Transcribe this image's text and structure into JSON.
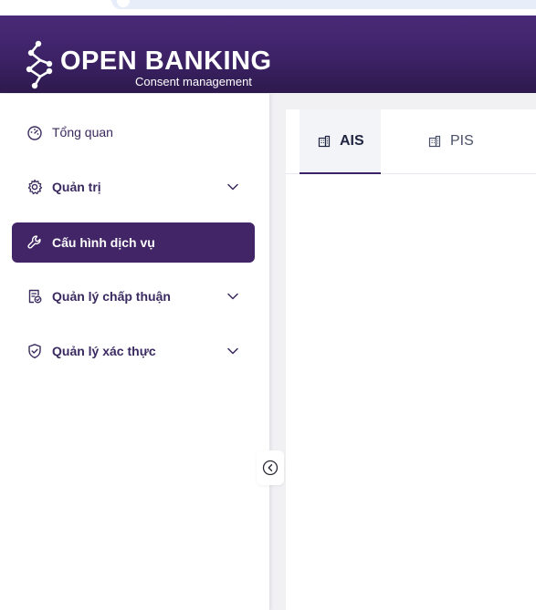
{
  "header": {
    "brand_title": "OPEN BANKING",
    "brand_subtitle": "Consent management"
  },
  "sidebar": {
    "items": [
      {
        "label": "Tổng quan",
        "icon": "dashboard-gauge-icon",
        "expandable": false,
        "active": false
      },
      {
        "label": "Quản trị",
        "icon": "gear-icon",
        "expandable": true,
        "active": false
      },
      {
        "label": "Cấu hình dịch vụ",
        "icon": "wrench-icon",
        "expandable": false,
        "active": true
      },
      {
        "label": "Quản lý chấp thuận",
        "icon": "document-check-icon",
        "expandable": true,
        "active": false
      },
      {
        "label": "Quản lý xác thực",
        "icon": "shield-check-icon",
        "expandable": true,
        "active": false
      }
    ],
    "collapse_icon": "chevron-left-circle-icon"
  },
  "tabs": [
    {
      "label": "AIS",
      "icon": "building-icon",
      "active": true
    },
    {
      "label": "PIS",
      "icon": "building-icon",
      "active": false
    }
  ],
  "colors": {
    "header_purple": "#3d2266",
    "active_item": "#422566",
    "nav_text": "#3b2a5e"
  }
}
